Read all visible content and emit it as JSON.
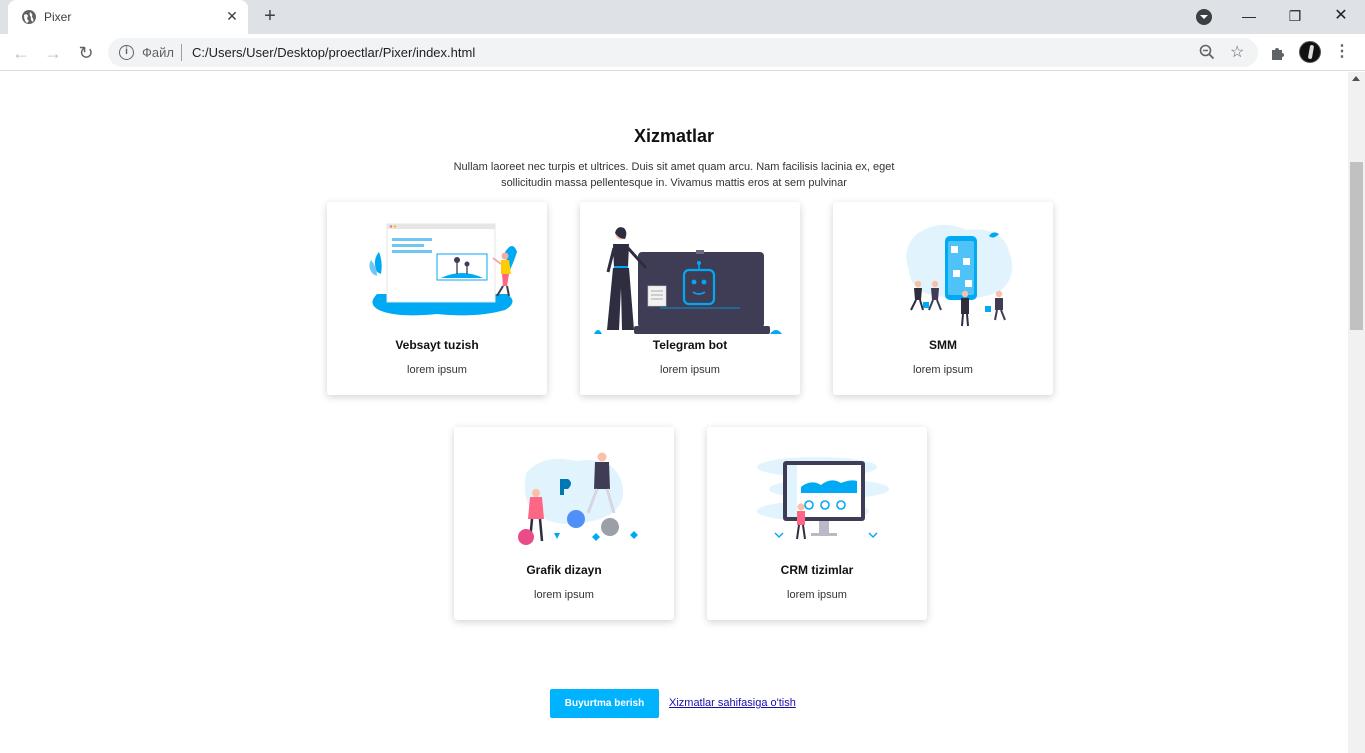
{
  "browser": {
    "tab_title": "Pixer",
    "tab_close": "✕",
    "new_tab": "+",
    "scheme_label": "Файл",
    "url": "C:/Users/User/Desktop/proectlar/Pixer/index.html",
    "minimize": "—",
    "restore": "❐",
    "close": "✕"
  },
  "section": {
    "title": "Xizmatlar",
    "description": "Nullam laoreet nec turpis et ultrices. Duis sit amet quam arcu. Nam facilisis lacinia ex, eget sollicitudin massa pellentesque in. Vivamus mattis eros at sem pulvinar"
  },
  "services": [
    {
      "title": "Vebsayt tuzish",
      "desc": "lorem ipsum"
    },
    {
      "title": "Telegram bot",
      "desc": "lorem ipsum"
    },
    {
      "title": "SMM",
      "desc": "lorem ipsum"
    },
    {
      "title": "Grafik dizayn",
      "desc": "lorem ipsum"
    },
    {
      "title": "CRM tizimlar",
      "desc": "lorem ipsum"
    }
  ],
  "actions": {
    "order_button": "Buyurtma berish",
    "services_link": "Xizmatlar sahifasiga o'tish"
  },
  "colors": {
    "accent": "#00b3ff",
    "illustration_dark": "#3f3d56"
  }
}
